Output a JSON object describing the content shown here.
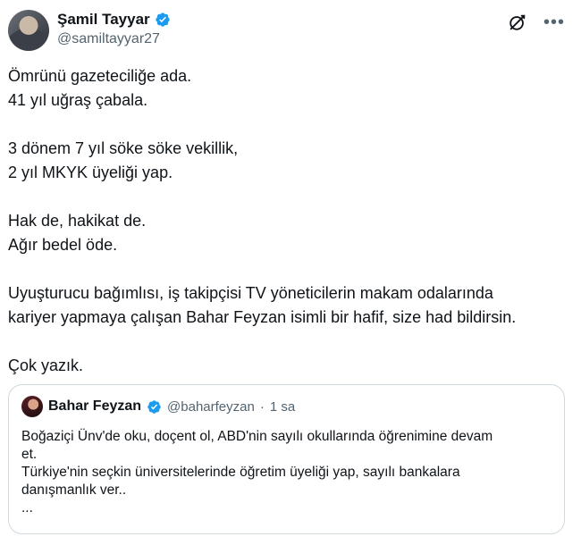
{
  "author": {
    "name": "Şamil Tayyar",
    "handle": "@samiltayyar27"
  },
  "tweet": {
    "lines": [
      "Ömrünü gazeteciliğe ada.",
      "41 yıl uğraş çabala.",
      "",
      "3 dönem 7 yıl söke söke vekillik,",
      "2 yıl MKYK üyeliği yap.",
      "",
      "Hak de, hakikat de.",
      "Ağır bedel öde.",
      "",
      "Uyuşturucu bağımlısı, iş takipçisi TV yöneticilerin makam odalarında",
      "kariyer yapmaya çalışan Bahar Feyzan isimli bir hafif, size had bildirsin.",
      "",
      "Çok yazık."
    ]
  },
  "quoted": {
    "name": "Bahar Feyzan",
    "handle": "@baharfeyzan",
    "separator": "·",
    "time": "1 sa",
    "lines": [
      "Boğaziçi Ünv'de oku, doçent ol, ABD'nin sayılı okullarında öğrenimine devam",
      "et.",
      "Türkiye'nin seçkin üniversitelerinde öğretim üyeliği yap, sayılı bankalara",
      "danışmanlık ver..",
      "..."
    ]
  },
  "icons": {
    "verified": "verified-badge-icon",
    "grok": "grok-icon",
    "more": "more-icon"
  },
  "colors": {
    "verified": "#1d9bf0",
    "secondary_text": "#536471",
    "border": "#cfd9de"
  }
}
